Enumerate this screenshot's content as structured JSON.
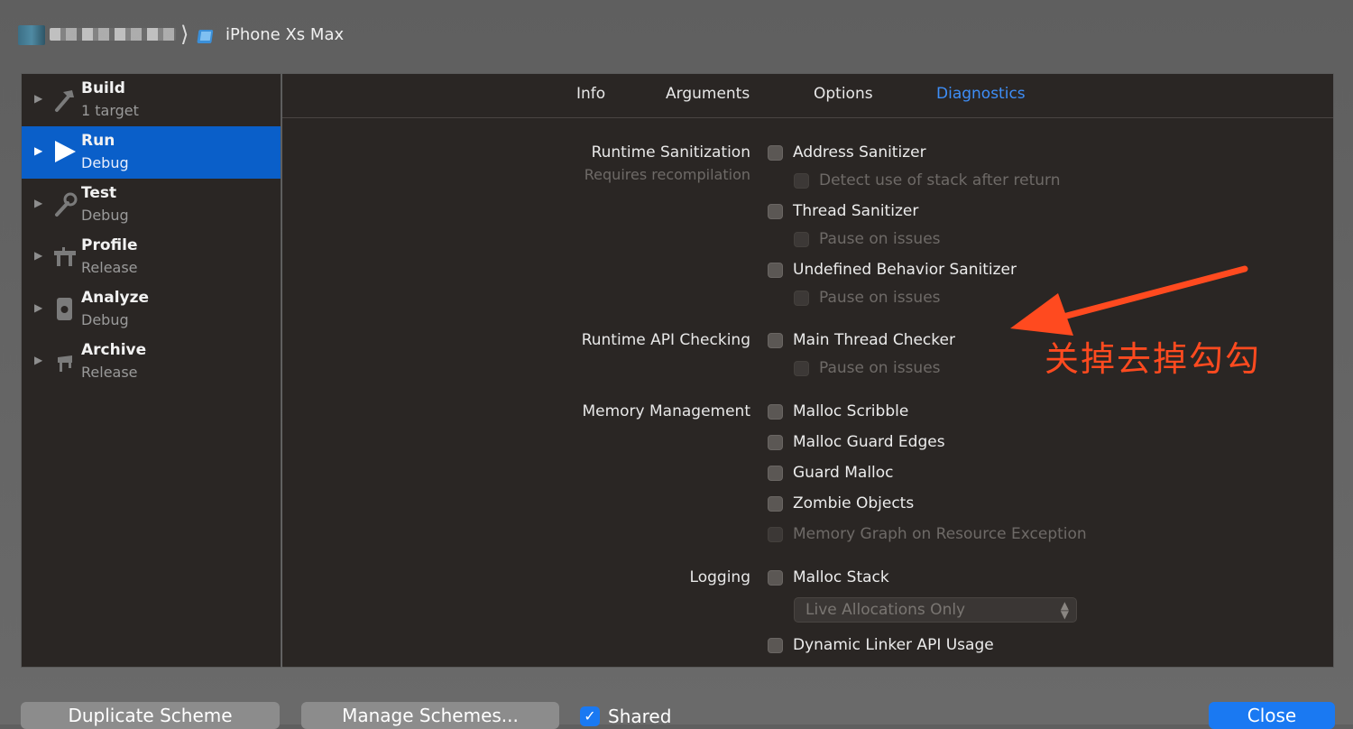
{
  "breadcrumb": {
    "device": "iPhone Xs Max"
  },
  "sidebar": {
    "items": [
      {
        "title": "Build",
        "subtitle": "1 target",
        "icon": "hammer-icon"
      },
      {
        "title": "Run",
        "subtitle": "Debug",
        "icon": "play-icon"
      },
      {
        "title": "Test",
        "subtitle": "Debug",
        "icon": "wrench-icon"
      },
      {
        "title": "Profile",
        "subtitle": "Release",
        "icon": "gauge-icon"
      },
      {
        "title": "Analyze",
        "subtitle": "Debug",
        "icon": "analyze-icon"
      },
      {
        "title": "Archive",
        "subtitle": "Release",
        "icon": "archive-icon"
      }
    ],
    "selected": "Run"
  },
  "tabs": [
    "Info",
    "Arguments",
    "Options",
    "Diagnostics"
  ],
  "active_tab": "Diagnostics",
  "sections": {
    "runtime_sanitization": "Runtime Sanitization",
    "runtime_sanitization_note": "Requires recompilation",
    "runtime_api_checking": "Runtime API Checking",
    "memory_management": "Memory Management",
    "logging": "Logging"
  },
  "options": {
    "address_sanitizer": "Address Sanitizer",
    "detect_stack_after_return": "Detect use of stack after return",
    "thread_sanitizer": "Thread Sanitizer",
    "thread_pause": "Pause on issues",
    "ub_sanitizer": "Undefined Behavior Sanitizer",
    "ub_pause": "Pause on issues",
    "main_thread_checker": "Main Thread Checker",
    "mtc_pause": "Pause on issues",
    "malloc_scribble": "Malloc Scribble",
    "malloc_guard_edges": "Malloc Guard Edges",
    "guard_malloc": "Guard Malloc",
    "zombie_objects": "Zombie Objects",
    "memory_graph": "Memory Graph on Resource Exception",
    "malloc_stack": "Malloc Stack",
    "malloc_stack_mode": "Live Allocations Only",
    "dynamic_linker": "Dynamic Linker API Usage"
  },
  "annotation": {
    "text": "关掉去掉勾勾",
    "color": "#ff4a1f"
  },
  "footer": {
    "duplicate": "Duplicate Scheme",
    "manage": "Manage Schemes...",
    "shared": "Shared",
    "shared_checked": true,
    "close": "Close"
  },
  "colors": {
    "accent": "#0a5fc9",
    "tab_active": "#3e8ef7",
    "primary_button": "#1a79f2"
  }
}
